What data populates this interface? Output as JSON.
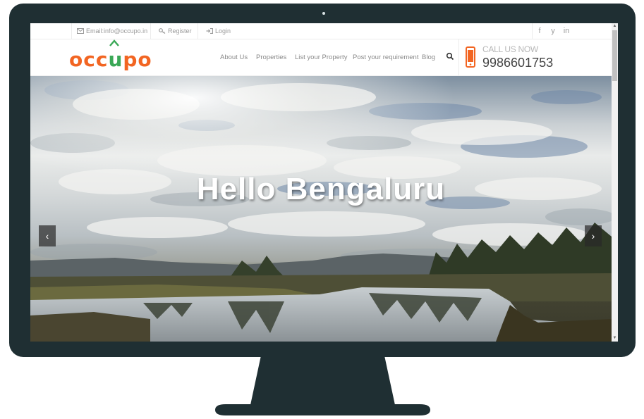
{
  "topbar": {
    "email_label": "Email:info@occupo.in",
    "register_label": "Register",
    "login_label": "Login",
    "social": [
      "f",
      "y",
      "in"
    ]
  },
  "logo": {
    "text_parts": [
      "occ",
      "u",
      "po"
    ]
  },
  "nav": {
    "items": [
      "About Us",
      "Properties",
      "List your Property",
      "Post your requirement",
      "Blog"
    ]
  },
  "call": {
    "label": "CALL US NOW",
    "number": "9986601753"
  },
  "hero": {
    "title": "Hello Bengaluru",
    "prev_arrow": "‹",
    "next_arrow": "›"
  },
  "colors": {
    "brand_orange": "#f26522",
    "brand_green": "#3aa856",
    "monitor_frame": "#1f2f33"
  },
  "icons": [
    "envelope-icon",
    "key-icon",
    "login-icon",
    "search-icon",
    "mobile-phone-icon",
    "facebook-icon",
    "twitter-icon",
    "linkedin-icon"
  ]
}
